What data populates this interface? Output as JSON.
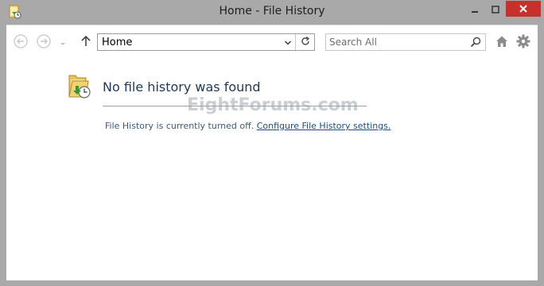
{
  "window": {
    "title": "Home - File History",
    "icon": "file-history-app-icon",
    "controls": [
      "minimize-icon",
      "maximize-icon",
      "close-icon"
    ],
    "close_color": "#c7302b"
  },
  "toolbar": {
    "back_icon": "back-arrow-icon",
    "forward_icon": "forward-arrow-icon",
    "recent_icon": "recent-dropdown-icon",
    "up_icon": "up-arrow-icon",
    "address_value": "Home",
    "search_placeholder": "Search All",
    "home_icon": "home-icon",
    "settings_icon": "gear-icon"
  },
  "main": {
    "heading": "No file history was found",
    "message_prefix": "File History is currently turned off.",
    "message_link": "Configure File History settings.",
    "watermark": "EightForums.com"
  }
}
